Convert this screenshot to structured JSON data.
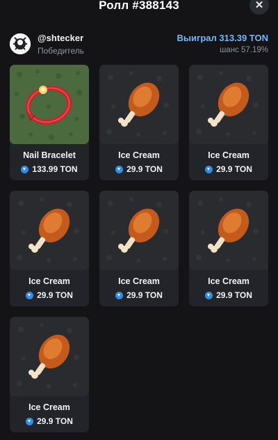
{
  "header": {
    "title": "Ролл #388143",
    "close_label": "✕"
  },
  "winner": {
    "username": "@shtecker",
    "role": "Победитель",
    "win_text": "Выиграл 313.39 TON",
    "chance_text": "шанс 57.19%"
  },
  "colors": {
    "background": "#141417",
    "card": "#22242a",
    "accent": "#79b6f2",
    "ton": "#2f8fe8"
  },
  "items": [
    {
      "name": "Nail Bracelet",
      "price": "133.99 TON",
      "icon": "bracelet-icon"
    },
    {
      "name": "Ice Cream",
      "price": "29.9 TON",
      "icon": "drumstick-icon"
    },
    {
      "name": "Ice Cream",
      "price": "29.9 TON",
      "icon": "drumstick-icon"
    },
    {
      "name": "Ice Cream",
      "price": "29.9 TON",
      "icon": "drumstick-icon"
    },
    {
      "name": "Ice Cream",
      "price": "29.9 TON",
      "icon": "drumstick-icon"
    },
    {
      "name": "Ice Cream",
      "price": "29.9 TON",
      "icon": "drumstick-icon"
    },
    {
      "name": "Ice Cream",
      "price": "29.9 TON",
      "icon": "drumstick-icon"
    }
  ]
}
